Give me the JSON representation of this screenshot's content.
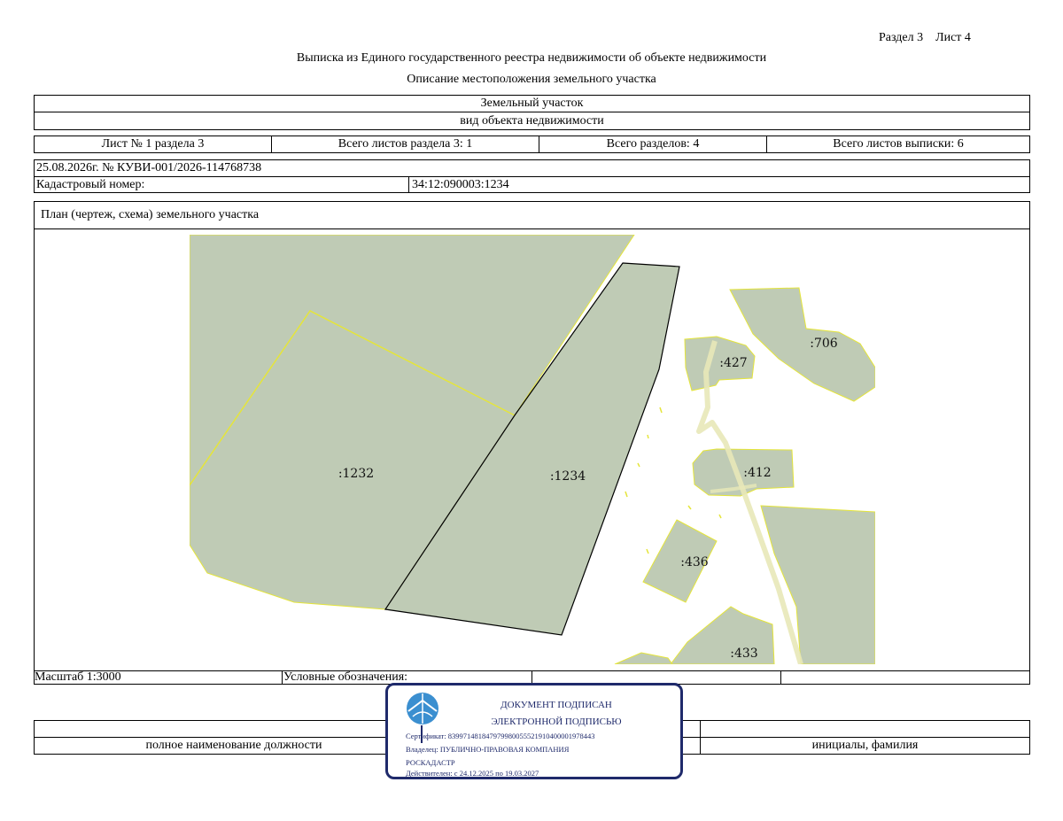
{
  "header": {
    "section_sheet": "Раздел 3    Лист 4",
    "title": "Выписка из Единого государственного реестра недвижимости об объекте недвижимости",
    "subtitle": "Описание местоположения земельного участка"
  },
  "object": {
    "type": "Земельный участок",
    "type_caption": "вид объекта недвижимости"
  },
  "sheets": {
    "sheet_no": "Лист № 1 раздела 3",
    "total_section_sheets": "Всего листов раздела 3: 1",
    "total_sections": "Всего разделов: 4",
    "total_extract_sheets": "Всего листов выписки: 6"
  },
  "record": {
    "date_number": "25.08.2026г. № КУВИ-001/2026-114768738",
    "cadastral_label": "Кадастровый номер:",
    "cadastral_value": "34:12:090003:1234"
  },
  "plan": {
    "title": "План (чертеж, схема) земельного участка",
    "colors": {
      "parcel_fill": "#bfcbb5",
      "road": "#e8e8b8",
      "border_yellow": "#e5e53a",
      "selected_border": "#000000"
    },
    "parcels": [
      {
        "label": ":1232"
      },
      {
        "label": ":1234",
        "selected": true
      },
      {
        "label": ":427"
      },
      {
        "label": ":706"
      },
      {
        "label": ":412"
      },
      {
        "label": ":436"
      },
      {
        "label": ":433"
      }
    ]
  },
  "footer": {
    "scale": "Масштаб 1:3000",
    "legend": "Условные обозначения:",
    "position_caption": "полное наименование должности",
    "name_caption": "инициалы, фамилия"
  },
  "stamp": {
    "line1": "ДОКУМЕНТ ПОДПИСАН",
    "line2": "ЭЛЕКТРОННОЙ ПОДПИСЬЮ",
    "certificate": "Сертификат: 839971481847979980055521910400001978443",
    "owner_line1": "Владелец: ПУБЛИЧНО-ПРАВОВАЯ КОМПАНИЯ",
    "owner_line2": "РОСКАДАСТР",
    "valid": "Действителен: с 24.12.2025 по 19.03.2027",
    "color": "#1f2a6b"
  }
}
